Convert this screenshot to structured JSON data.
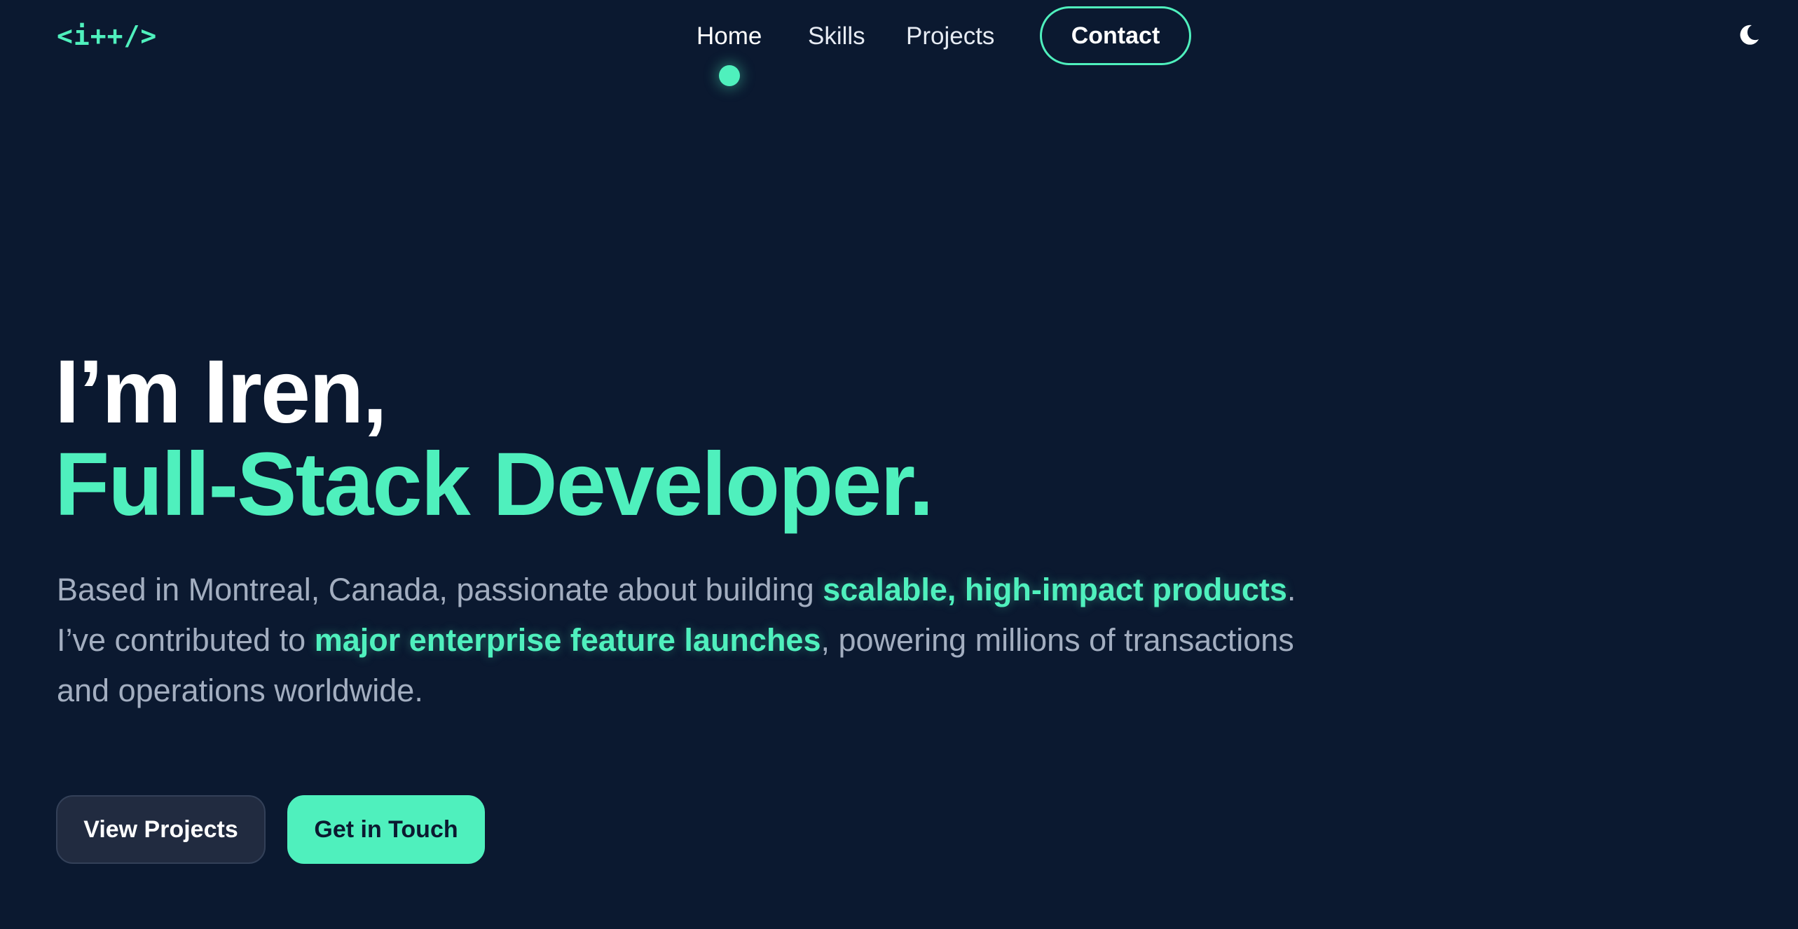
{
  "header": {
    "logo": "<i++/>",
    "nav": {
      "home": "Home",
      "skills": "Skills",
      "projects": "Projects",
      "contact": "Contact",
      "active": "Home"
    },
    "theme_toggle_icon": "moon-icon"
  },
  "hero": {
    "greeting": "I’m Iren,",
    "role": "Full-Stack Developer.",
    "description": {
      "part1": "Based in Montreal, Canada, passionate about building ",
      "highlight1": "scalable, high-impact products",
      "part2": ". I’ve contributed to ",
      "highlight2": "major enterprise feature launches",
      "part3": ", powering millions of transactions and operations worldwide."
    },
    "buttons": {
      "view_projects": "View Projects",
      "get_in_touch": "Get in Touch"
    }
  },
  "colors": {
    "background": "#0b1930",
    "accent": "#4ff0bd",
    "text_primary": "#ffffff",
    "text_muted": "#a3aec0",
    "secondary_button": "#212b40"
  }
}
